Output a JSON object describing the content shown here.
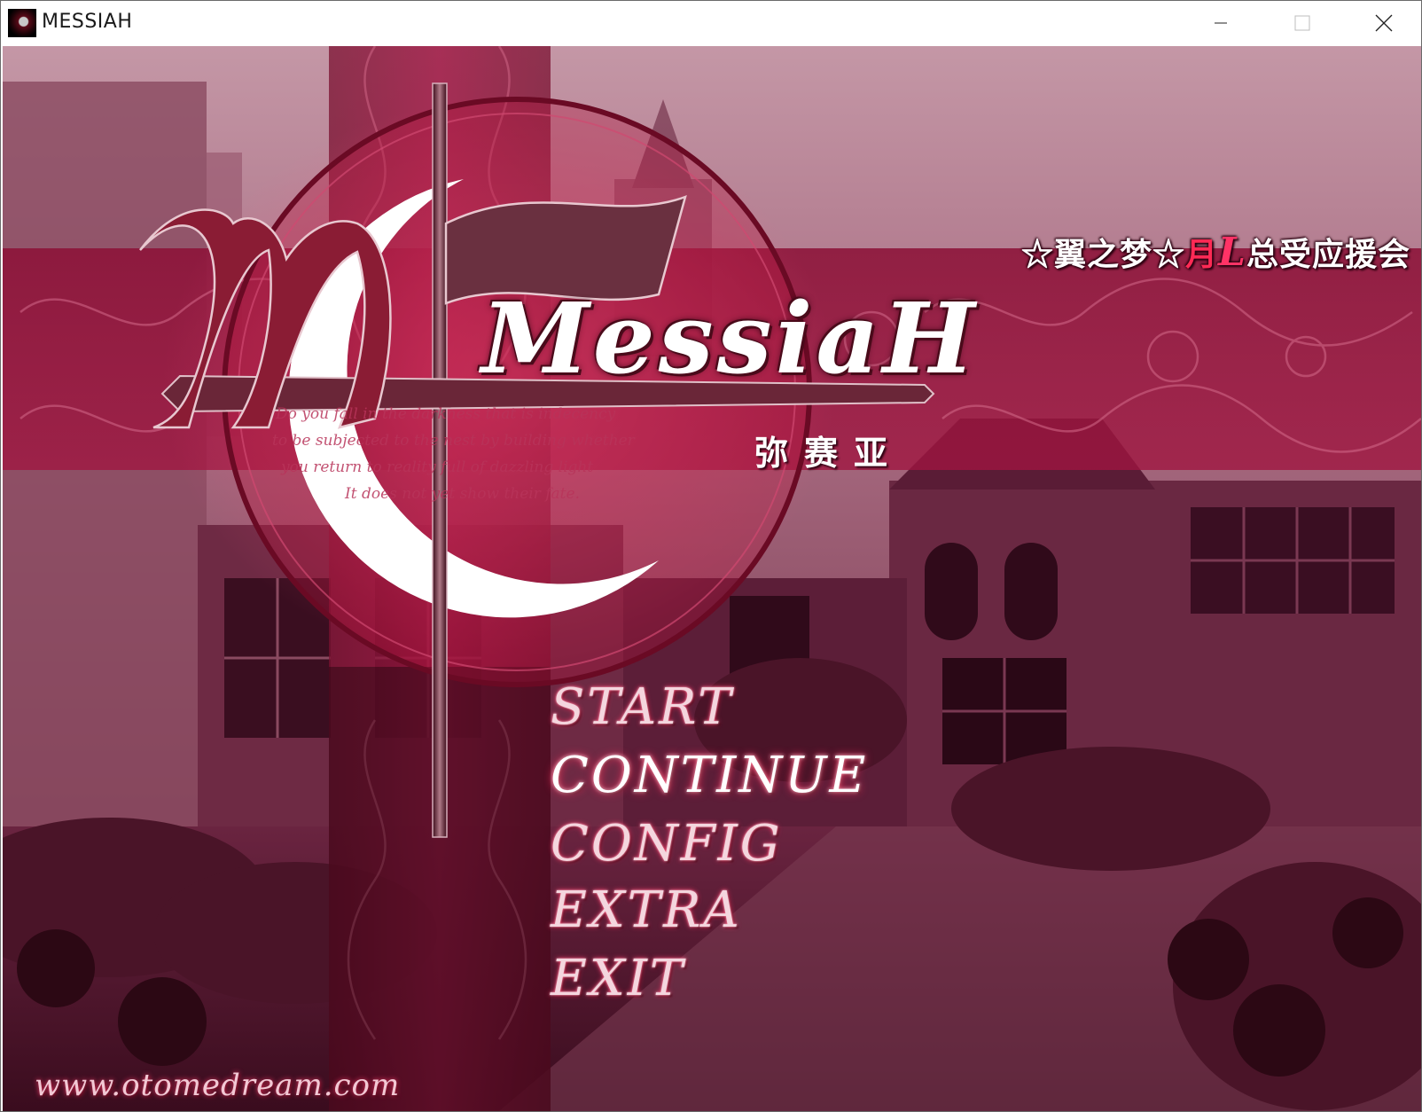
{
  "window": {
    "title": "MESSIAH",
    "icon": "messiah-app-icon",
    "controls": [
      "minimize-icon",
      "maximize-icon",
      "close-icon"
    ]
  },
  "game": {
    "logo_text": "MessiaH",
    "logo_chinese": "弥赛亚",
    "group_banner": {
      "prefix": "☆翼之梦☆",
      "moon": "月",
      "ell": "L",
      "suffix": "总受应援会"
    },
    "poem_lines": [
      "Do you fall in the darkness that is indecency",
      "to be subjected to the nest by building whether",
      "you return to reality full of dazzling light",
      "It does not yet show their fate."
    ],
    "menu": [
      {
        "key": "start",
        "label": "START"
      },
      {
        "key": "continue",
        "label": "CONTINUE"
      },
      {
        "key": "config",
        "label": "CONFIG"
      },
      {
        "key": "extra",
        "label": "EXTRA"
      },
      {
        "key": "exit",
        "label": "EXIT"
      }
    ],
    "site_url": "www.otomedream.com"
  },
  "colors": {
    "crimson": "#b0103a",
    "dark_wine": "#4a1426",
    "menu_glow": "#ff3a6a",
    "banner_red": "#ff2a55"
  }
}
